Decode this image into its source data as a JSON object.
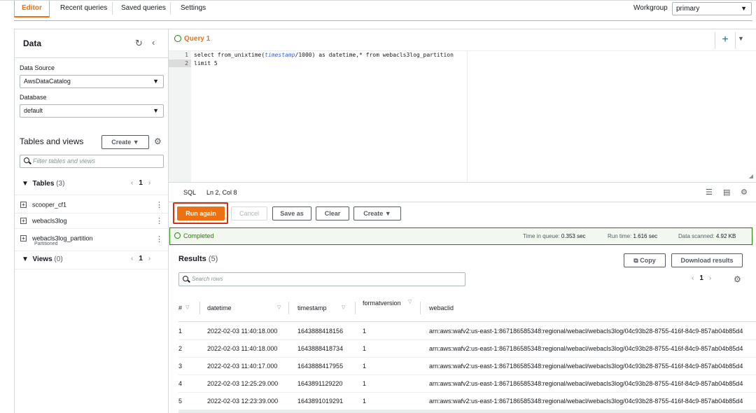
{
  "top_tabs": [
    "Editor",
    "Recent queries",
    "Saved queries",
    "Settings"
  ],
  "workgroup": {
    "label": "Workgroup",
    "value": "primary"
  },
  "left": {
    "title": "Data",
    "data_source_label": "Data Source",
    "data_source_value": "AwsDataCatalog",
    "database_label": "Database",
    "database_value": "default",
    "tables_views_title": "Tables and views",
    "create_label": "Create",
    "filter_placeholder": "Filter tables and views",
    "tables_label": "Tables",
    "tables_count": "(3)",
    "tables_page": "1",
    "tables": [
      {
        "name": "scooper_cf1",
        "sub": ""
      },
      {
        "name": "webacls3log",
        "sub": ""
      },
      {
        "name": "webacls3log_partition",
        "sub": "Partitioned"
      }
    ],
    "views_label": "Views",
    "views_count": "(0)",
    "views_page": "1"
  },
  "editor": {
    "tab_title": "Query 1",
    "lines": [
      "1",
      "2"
    ],
    "code_line1_a": "select from_unixtime(",
    "code_line1_it": "timestamp",
    "code_line1_b": "/1000) as datetime,* from webacls3log_partition",
    "code_line2": "limit 5",
    "lang": "SQL",
    "position": "Ln 2, Col 8"
  },
  "actions": {
    "run_again": "Run again",
    "cancel": "Cancel",
    "save_as": "Save as",
    "clear": "Clear",
    "create": "Create"
  },
  "status": {
    "completed": "Completed",
    "time_in_queue_label": "Time in queue:",
    "time_in_queue": "0.353 sec",
    "run_time_label": "Run time:",
    "run_time": "1.616 sec",
    "data_scanned_label": "Data scanned:",
    "data_scanned": "4.92 KB"
  },
  "results": {
    "title": "Results",
    "count": "(5)",
    "copy": "Copy",
    "download": "Download results",
    "search_placeholder": "Search rows",
    "page": "1",
    "columns": [
      "#",
      "datetime",
      "timestamp",
      "formatversion",
      "webaclid"
    ],
    "rows": [
      [
        "1",
        "2022-02-03 11:40:18.000",
        "1643888418156",
        "1",
        "arn:aws:wafv2:us-east-1:867186585348:regional/webacl/webacls3log/04c93b28-8755-416f-84c9-857ab04b85d4"
      ],
      [
        "2",
        "2022-02-03 11:40:18.000",
        "1643888418734",
        "1",
        "arn:aws:wafv2:us-east-1:867186585348:regional/webacl/webacls3log/04c93b28-8755-416f-84c9-857ab04b85d4"
      ],
      [
        "3",
        "2022-02-03 11:40:17.000",
        "1643888417955",
        "1",
        "arn:aws:wafv2:us-east-1:867186585348:regional/webacl/webacls3log/04c93b28-8755-416f-84c9-857ab04b85d4"
      ],
      [
        "4",
        "2022-02-03 12:25:29.000",
        "1643891129220",
        "1",
        "arn:aws:wafv2:us-east-1:867186585348:regional/webacl/webacls3log/04c93b28-8755-416f-84c9-857ab04b85d4"
      ],
      [
        "5",
        "2022-02-03 12:23:39.000",
        "1643891019291",
        "1",
        "arn:aws:wafv2:us-east-1:867186585348:regional/webacl/webacls3log/04c93b28-8755-416f-84c9-857ab04b85d4"
      ]
    ]
  },
  "colors": {
    "accent": "#ec7211",
    "success": "#1d8102",
    "highlight": "#d13212",
    "link": "#0073bb"
  }
}
